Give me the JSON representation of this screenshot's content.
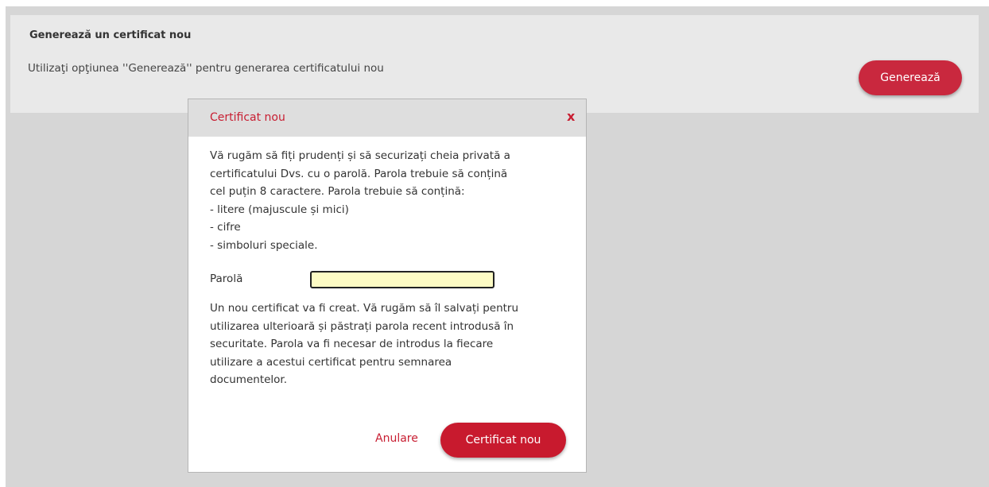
{
  "panel": {
    "title": "Generează un certificat nou",
    "description": "Utilizaţi opţiunea ''Generează'' pentru generarea certificatului nou",
    "button_label": "Generează"
  },
  "modal": {
    "title": "Certificat nou",
    "close_label": "x",
    "intro_lines": [
      "Vă rugăm să fiți prudenți și să securizați cheia privată a",
      "certificatului Dvs. cu o parolă. Parola trebuie să conțină",
      "cel puțin 8 caractere. Parola trebuie să conțină:",
      "- litere (majuscule și mici)",
      "- cifre",
      "- simboluri speciale."
    ],
    "password_label": "Parolă",
    "password_value": "",
    "outro_lines": [
      "Un nou certificat va fi creat. Vă rugăm să îl salvați pentru",
      "utilizarea ulterioară și păstrați parola recent introdusă în",
      "securitate. Parola va fi necesar de introdus la fiecare",
      "utilizare a acestui certificat pentru semnarea",
      "documentelor."
    ],
    "cancel_label": "Anulare",
    "confirm_label": "Certificat nou"
  },
  "colors": {
    "accent": "#c81e32",
    "backdrop": "#d6d6d6",
    "panel": "#e9e9e9",
    "input_background": "#fdfbc4"
  }
}
